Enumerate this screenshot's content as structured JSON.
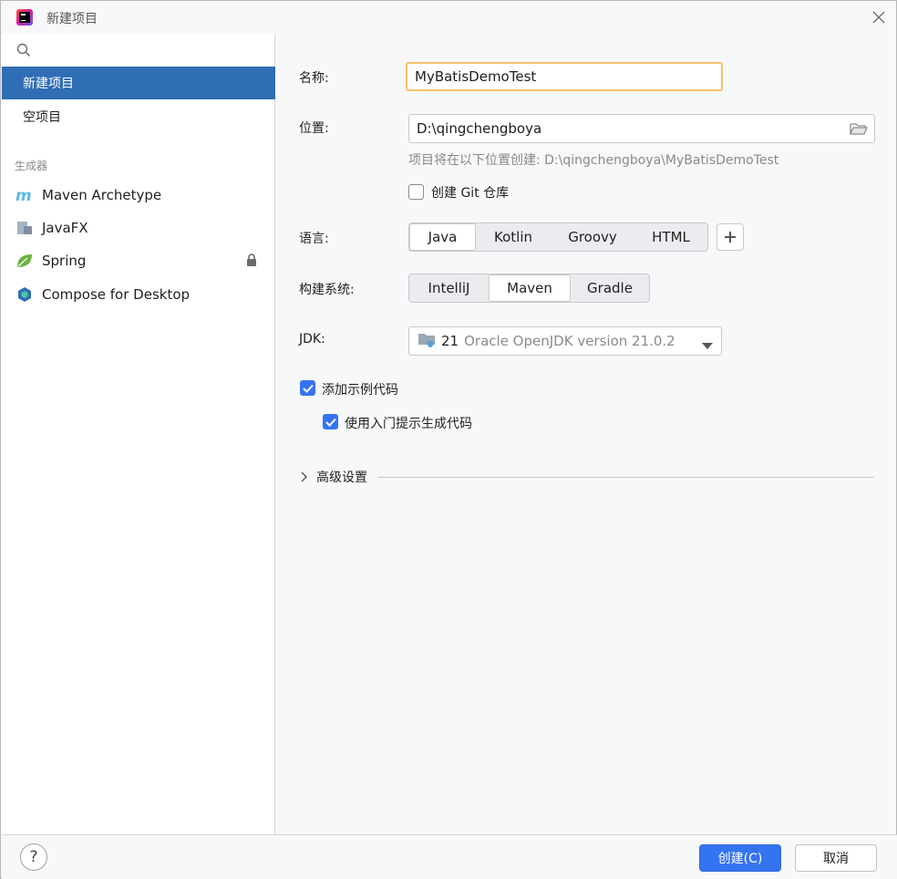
{
  "window": {
    "title": "新建项目"
  },
  "sidebar": {
    "search_placeholder": "",
    "nav_items": [
      {
        "label": "新建项目",
        "selected": true
      },
      {
        "label": "空项目",
        "selected": false
      }
    ],
    "generators_label": "生成器",
    "generators": [
      {
        "label": "Maven Archetype",
        "icon": "maven-icon"
      },
      {
        "label": "JavaFX",
        "icon": "javafx-icon"
      },
      {
        "label": "Spring",
        "icon": "spring-leaf-icon",
        "locked": true
      },
      {
        "label": "Compose for Desktop",
        "icon": "compose-icon"
      }
    ]
  },
  "form": {
    "name_label": "名称:",
    "name_value": "MyBatisDemoTest",
    "location_label": "位置:",
    "location_value": "D:\\qingchengboya",
    "location_hint": "项目将在以下位置创建: D:\\qingchengboya\\MyBatisDemoTest",
    "git_label": "创建 Git 仓库",
    "git_checked": false,
    "language_label": "语言:",
    "languages": [
      "Java",
      "Kotlin",
      "Groovy",
      "HTML"
    ],
    "language_selected": "Java",
    "build_label": "构建系统:",
    "build_systems": [
      "IntelliJ",
      "Maven",
      "Gradle"
    ],
    "build_selected": "Maven",
    "jdk_label": "JDK:",
    "jdk_version": "21",
    "jdk_desc": "Oracle OpenJDK version 21.0.2",
    "sample_code_label": "添加示例代码",
    "sample_code_checked": true,
    "onboarding_label": "使用入门提示生成代码",
    "onboarding_checked": true,
    "advanced_label": "高级设置"
  },
  "footer": {
    "help_label": "?",
    "create_label": "创建(C)",
    "cancel_label": "取消"
  },
  "colors": {
    "accent": "#3574f0",
    "selection": "#2f6db5",
    "focus_border": "#f6c16b"
  }
}
